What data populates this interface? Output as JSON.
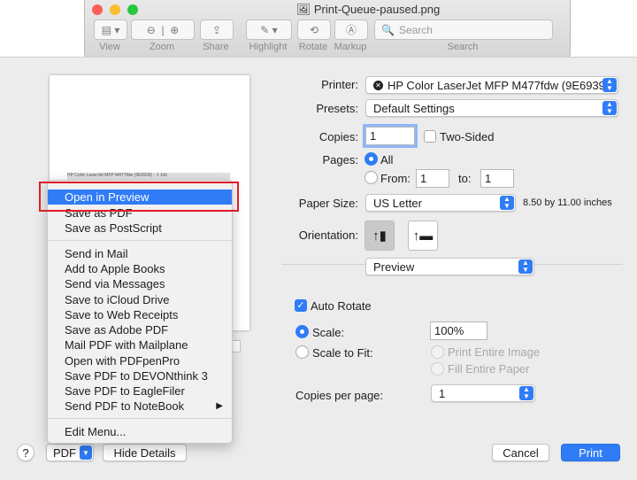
{
  "window": {
    "title": "Print-Queue-paused.png",
    "toolbar": [
      {
        "label": "View",
        "icon": "sidebar-icon"
      },
      {
        "label": "Zoom",
        "icon": "zoom-icon"
      },
      {
        "label": "Share",
        "icon": "share-icon"
      },
      {
        "label": "Highlight",
        "icon": "highlighter-icon"
      },
      {
        "label": "Rotate",
        "icon": "rotate-icon"
      },
      {
        "label": "Markup",
        "icon": "markup-icon"
      },
      {
        "label": "Search",
        "icon": "search-icon"
      }
    ],
    "search_placeholder": "Search"
  },
  "preview": {
    "thumbnail_text": "HP Color LaserJet MFP M477fdw (9E6939) - 1 Job"
  },
  "print": {
    "printer_label": "Printer:",
    "printer_value": "HP Color LaserJet MFP M477fdw (9E6939)",
    "presets_label": "Presets:",
    "presets_value": "Default Settings",
    "copies_label": "Copies:",
    "copies_value": "1",
    "two_sided_label": "Two-Sided",
    "pages_label": "Pages:",
    "pages_all": "All",
    "pages_from": "From:",
    "from_value": "1",
    "to_label": "to:",
    "to_value": "1",
    "paper_label": "Paper Size:",
    "paper_value": "US Letter",
    "paper_dims": "8.50 by 11.00 inches",
    "orientation_label": "Orientation:",
    "section_value": "Preview",
    "auto_rotate": "Auto Rotate",
    "scale_label": "Scale:",
    "scale_value": "100%",
    "scale_to_fit": "Scale to Fit:",
    "print_entire": "Print Entire Image",
    "fill_entire": "Fill Entire Paper",
    "copies_per_page_label": "Copies per page:",
    "copies_per_page_value": "1"
  },
  "buttons": {
    "help": "?",
    "pdf": "PDF",
    "hide_details": "Hide Details",
    "cancel": "Cancel",
    "print": "Print"
  },
  "menu": {
    "group1": [
      "Open in Preview",
      "Save as PDF",
      "Save as PostScript"
    ],
    "group2": [
      "Send in Mail",
      "Add to Apple Books",
      "Send via Messages",
      "Save to iCloud Drive",
      "Save to Web Receipts",
      "Save as Adobe PDF",
      "Mail PDF with Mailplane",
      "Open with PDFpenPro",
      "Save PDF to DEVONthink 3",
      "Save PDF to EagleFiler",
      "Send PDF to NoteBook"
    ],
    "edit": "Edit Menu...",
    "submenu_arrow": "▶"
  },
  "colors": {
    "accent": "#2f7cf6",
    "highlight_box": "#e11c24"
  }
}
